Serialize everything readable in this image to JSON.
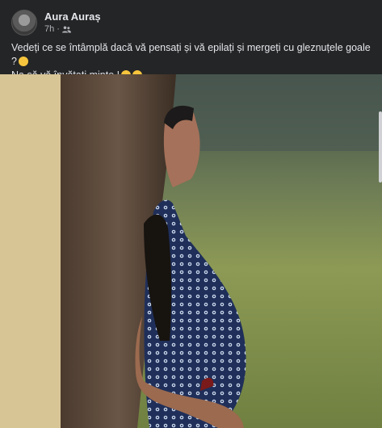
{
  "post": {
    "author": "Aura Auraș",
    "time": "7h",
    "separator": "·",
    "audience_icon": "friends-icon",
    "text_line1": "Vedeți ce se întâmplă dacă vă pensați și vă epilați și mergeți cu gleznuțele goale ?",
    "text_line2": "Na,să vă învățați minte !",
    "emoji_line1": "smiling-face-with-open-mouth-emoji",
    "emoji_line2": [
      "grinning-sweat-emoji",
      "laughing-tears-emoji"
    ]
  },
  "colors": {
    "background": "#242526",
    "text": "#e4e6eb",
    "secondary_text": "#b0b3b8",
    "emoji_yellow": "#f7c53d"
  }
}
